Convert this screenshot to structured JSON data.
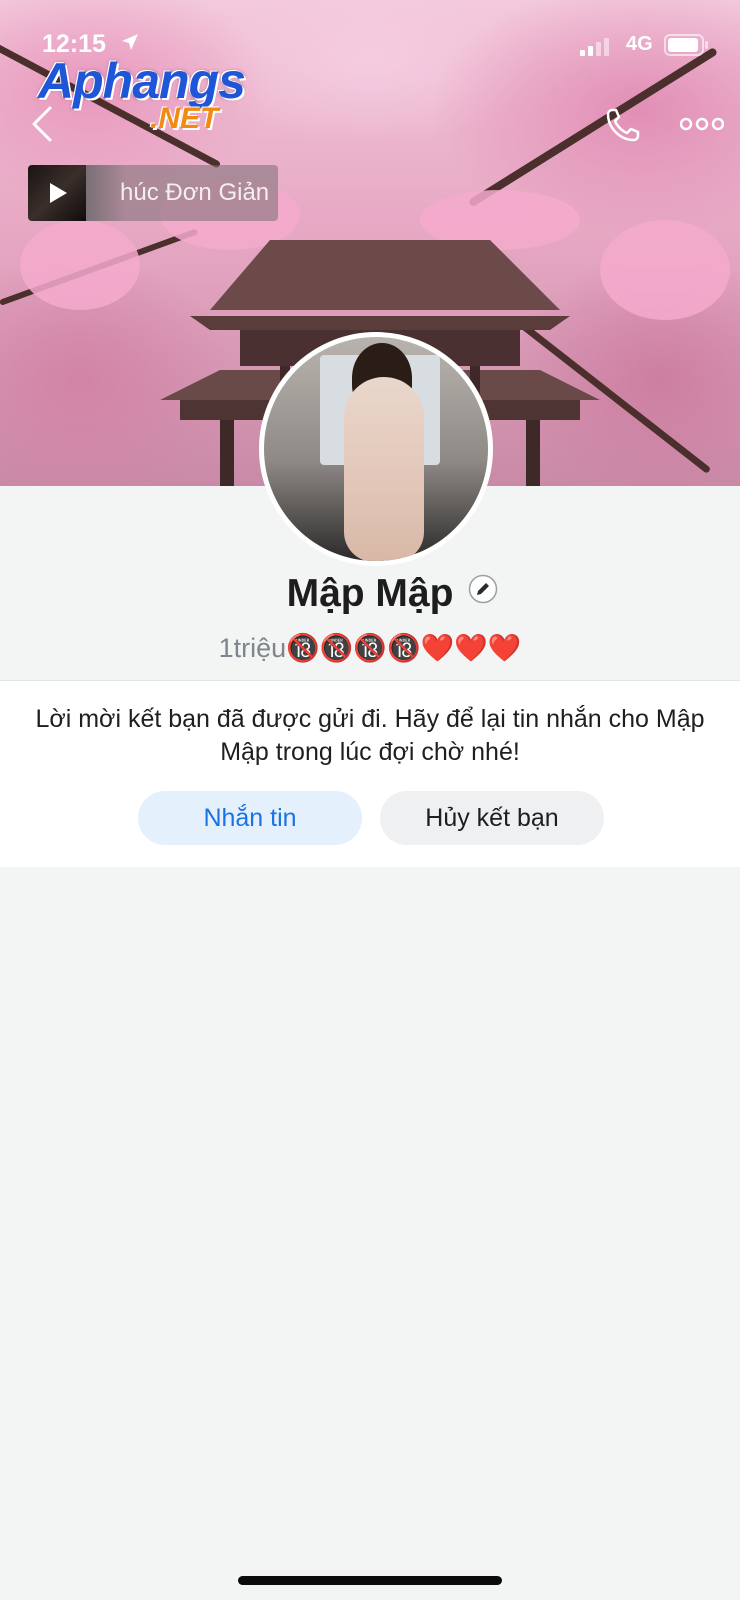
{
  "status_bar": {
    "time": "12:15",
    "network": "4G",
    "icons": [
      "location-arrow-icon",
      "signal-icon",
      "battery-icon"
    ]
  },
  "watermark": {
    "main": "Aphangs",
    "sub": ".NET"
  },
  "nav": {
    "icons": [
      "back-icon",
      "phone-icon",
      "more-icon"
    ]
  },
  "music": {
    "title": "húc Đơn Giản"
  },
  "profile": {
    "name": "Mập Mập",
    "bio": "1triệu🔞🔞🔞🔞❤️❤️❤️"
  },
  "friend_request": {
    "message": "Lời mời kết bạn đã được gửi đi. Hãy để lại tin nhắn cho Mập Mập trong lúc đợi chờ nhé!",
    "message_button": "Nhắn tin",
    "cancel_button": "Hủy kết bạn"
  },
  "colors": {
    "accent": "#1a73e0",
    "message_button_bg": "#e5f0fd",
    "cancel_button_bg": "#eef0f2",
    "page_bg": "#f3f4f4"
  }
}
